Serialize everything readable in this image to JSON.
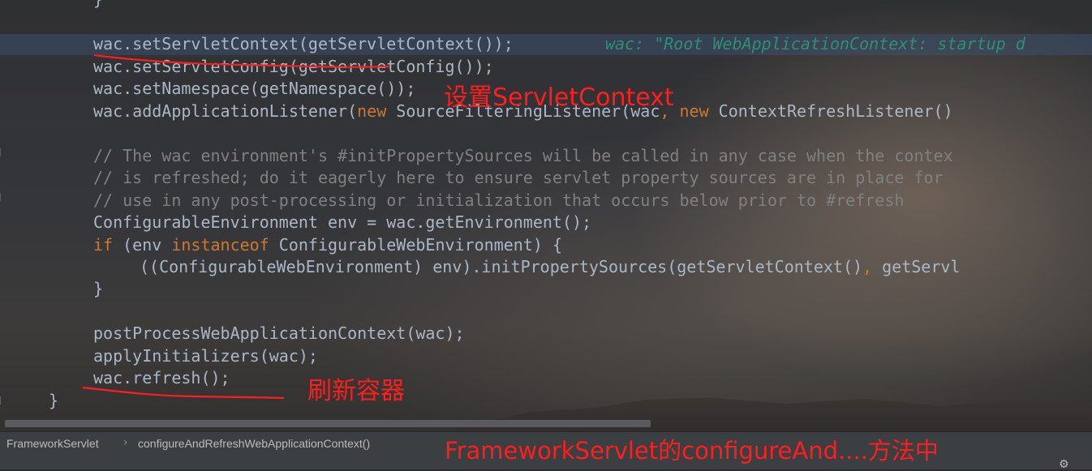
{
  "code": {
    "lines": {
      "brace_top": "}",
      "l1": "wac.setServletContext(getServletContext());",
      "l1_hint": "wac: \"Root WebApplicationContext: startup d",
      "l2": "wac.setServletConfig(getServletConfig());",
      "l3": "wac.setNamespace(getNamespace());",
      "l4_a": "wac.addApplicationListener(",
      "l4_new1": "new",
      "l4_b": " SourceFilteringListener(wac",
      "l4_comma": ",",
      "l4_new2": "new",
      "l4_c": " ContextRefreshListener()",
      "c1": "// The wac environment's #initPropertySources will be called in any case when the contex",
      "c2": "// is refreshed; do it eagerly here to ensure servlet property sources are in place for",
      "c3": "// use in any post-processing or initialization that occurs below prior to #refresh",
      "l5": "ConfigurableEnvironment env = wac.getEnvironment();",
      "l6_if": "if",
      "l6_a": " (env ",
      "l6_instanceof": "instanceof",
      "l6_b": " ConfigurableWebEnvironment) {",
      "l7_a": "((ConfigurableWebEnvironment) env).initPropertySources(getServletContext()",
      "l7_comma": ",",
      "l7_b": " getServl",
      "brace_inner": "}",
      "l8": "postProcessWebApplicationContext(wac);",
      "l9": "applyInitializers(wac);",
      "l10": "wac.refresh();",
      "brace_close": "}"
    }
  },
  "annotations": {
    "set_servlet_context": "设置ServletContext",
    "refresh_container": "刷新容器",
    "method_note": "FrameworkServlet的configureAnd....方法中"
  },
  "breadcrumb": {
    "class_name": "FrameworkServlet",
    "method_name": "configureAndRefreshWebApplicationContext()"
  },
  "icons": {
    "separator": "chevron-right-icon",
    "settings": "gear-icon"
  },
  "colors": {
    "annotation_red": "#ff1e1e",
    "keyword": "#cc7832",
    "comment": "#808080",
    "default_text": "#a9b7c6",
    "hint_text": "#2f8f72"
  }
}
